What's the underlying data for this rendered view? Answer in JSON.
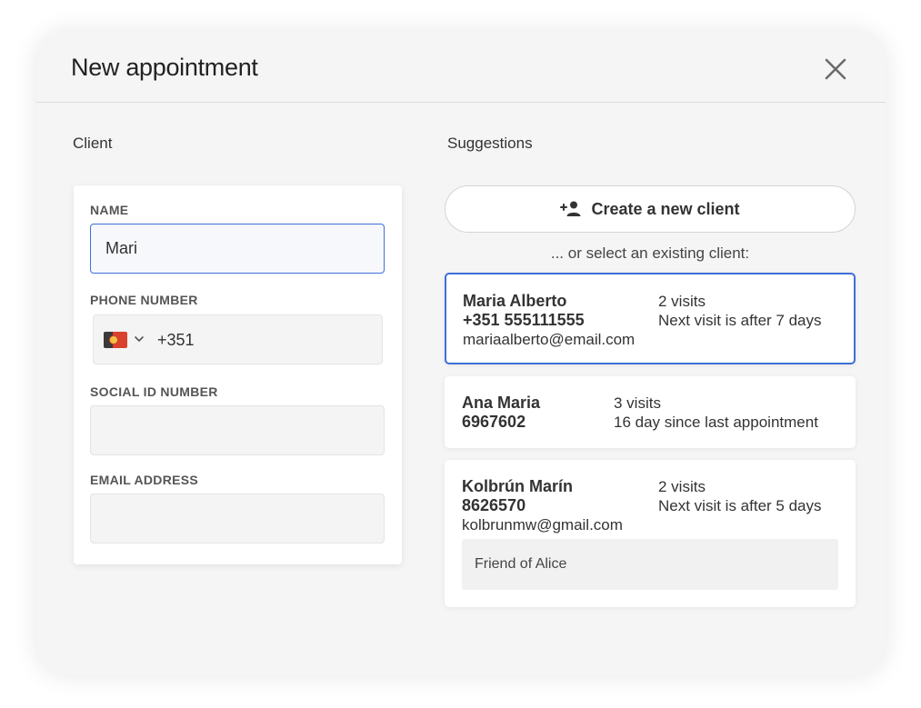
{
  "dialog": {
    "title": "New appointment",
    "close_icon": "close-icon"
  },
  "client": {
    "section_label": "Client",
    "name_label": "NAME",
    "name_value": "Mari",
    "phone_label": "PHONE NUMBER",
    "phone_prefix": "+351",
    "phone_flag_icon": "portugal-flag-icon",
    "social_id_label": "SOCIAL ID NUMBER",
    "social_id_value": "",
    "email_label": "EMAIL ADDRESS",
    "email_value": ""
  },
  "suggestions": {
    "section_label": "Suggestions",
    "create_button_label": "Create a new client",
    "create_button_icon": "add-person-icon",
    "or_select_text": "... or select an existing client:",
    "items": [
      {
        "name": "Maria Alberto",
        "phone": "+351 555111555",
        "email": "mariaalberto@email.com",
        "visits": "2 visits",
        "status": "Next visit is after 7 days"
      },
      {
        "name": "Ana Maria",
        "phone": "6967602",
        "visits": "3 visits",
        "status": "16 day since last appointment"
      },
      {
        "name": "Kolbrún Marín",
        "phone": "8626570",
        "email": "kolbrunmw@gmail.com",
        "visits": "2 visits",
        "status": "Next visit is after 5 days",
        "note": "Friend of Alice"
      }
    ]
  },
  "colors": {
    "accent": "#3e6fd8",
    "modal_background": "#f5f5f5",
    "card_background": "#ffffff"
  }
}
